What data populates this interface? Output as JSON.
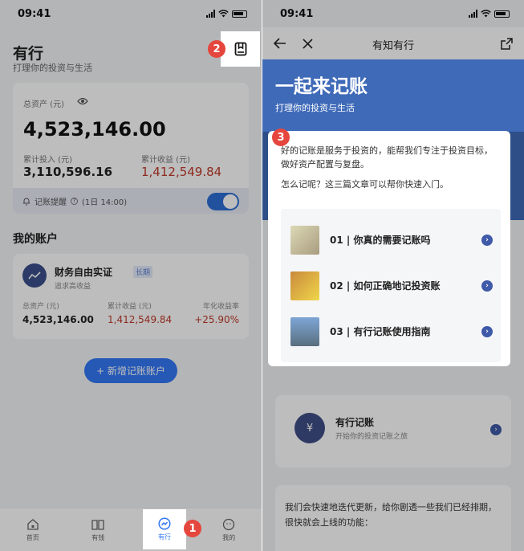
{
  "status": {
    "time": "09:41"
  },
  "left": {
    "title": "有行",
    "subtitle": "打理你的投资与生活",
    "asset_card": {
      "total_label": "总资产 (元)",
      "total_value": "4,523,146.00",
      "invest_label": "累计投入 (元)",
      "invest_value": "3,110,596.16",
      "profit_label": "累计收益 (元)",
      "profit_value": "1,412,549.84",
      "reminder_label": "记账提醒",
      "reminder_time": "(1日 14:00)"
    },
    "accounts_title": "我的账户",
    "account": {
      "name": "财务自由实证",
      "tag": "长期",
      "desc": "追求高收益",
      "total_label": "总资产 (元)",
      "total_value": "4,523,146.00",
      "profit_label": "累计收益 (元)",
      "profit_value": "1,412,549.84",
      "rate_label": "年化收益率",
      "rate_value": "+25.90%"
    },
    "add_button": "+ 新增记账账户",
    "tabs": [
      "首页",
      "有钱",
      "有行",
      "我的"
    ]
  },
  "right": {
    "nav_title": "有知有行",
    "banner_title": "一起来记账",
    "banner_subtitle": "打理你的投资与生活",
    "intro_1": "好的记账是服务于投资的，能帮我们专注于投资目标，做好资产配置与复盘。",
    "intro_2": "怎么记呢？这三篇文章可以帮你快速入门。",
    "articles": [
      "01 | 你真的需要记账吗",
      "02 | 如何正确地记投资账",
      "03 | 有行记账使用指南"
    ],
    "record_title": "有行记账",
    "record_sub": "开始你的投资记账之旅",
    "update_text": "我们会快速地迭代更新，给你剧透一些我们已经排期，很快就会上线的功能："
  },
  "steps": [
    "1",
    "2",
    "3"
  ],
  "colors": {
    "accent": "#3478f6",
    "profit": "#c0392b",
    "banner": "#3f6ab8",
    "badge": "#e5463d"
  }
}
